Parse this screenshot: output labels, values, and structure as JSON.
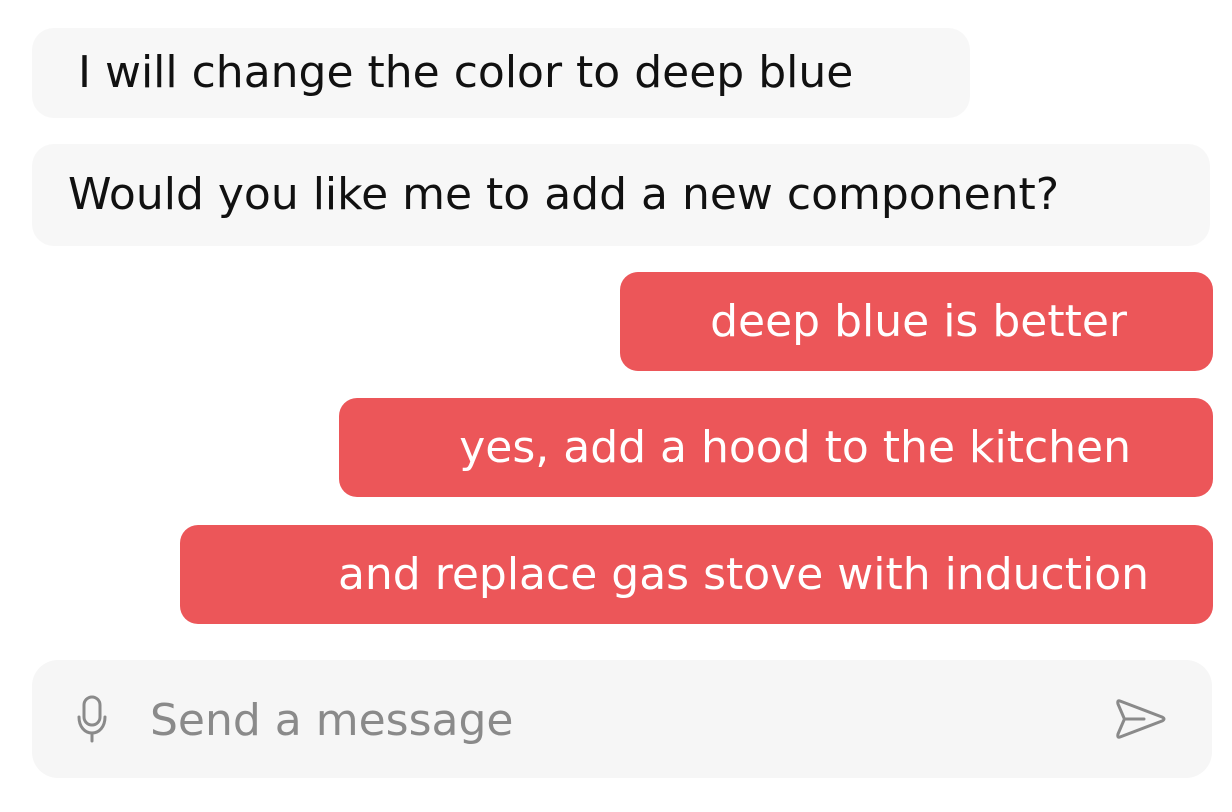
{
  "messages": [
    {
      "role": "assistant",
      "text": "I will change the color to deep blue"
    },
    {
      "role": "assistant",
      "text": "Would you like me to add a new component?"
    },
    {
      "role": "user",
      "text": "deep blue is better"
    },
    {
      "role": "user",
      "text": "yes, add a hood to the kitchen"
    },
    {
      "role": "user",
      "text": "and replace gas stove with induction"
    }
  ],
  "composer": {
    "placeholder": "Send a message",
    "value": "",
    "mic_icon": "microphone-icon",
    "send_icon": "send-icon"
  },
  "colors": {
    "assistant_bubble": "#f7f7f7",
    "user_bubble": "#ec5659",
    "user_text": "#ffffff",
    "composer_bg": "#f6f6f6",
    "placeholder": "#8a8a8a"
  }
}
